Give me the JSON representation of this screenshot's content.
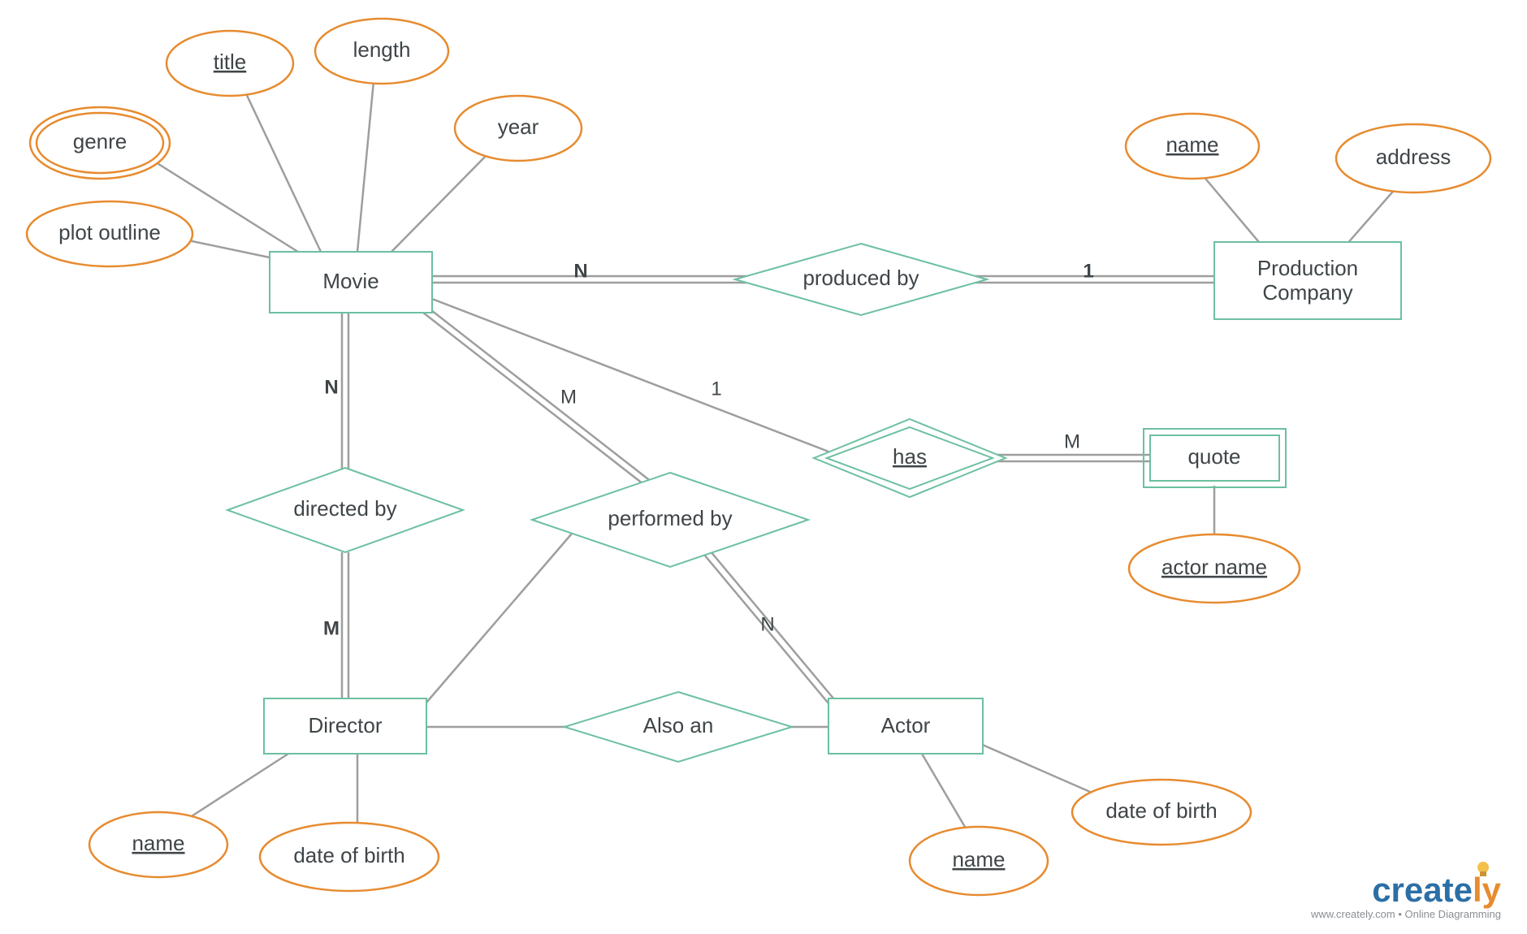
{
  "entities": {
    "movie": "Movie",
    "production_company_l1": "Production",
    "production_company_l2": "Company",
    "director": "Director",
    "actor": "Actor",
    "quote": "quote"
  },
  "relationships": {
    "produced_by": "produced by",
    "directed_by": "directed by",
    "performed_by": "performed by",
    "has": "has",
    "also_an": "Also an"
  },
  "attributes": {
    "movie": {
      "genre": "genre",
      "title": "title",
      "length": "length",
      "year": "year",
      "plot_outline": "plot outline"
    },
    "production_company": {
      "name": "name",
      "address": "address"
    },
    "director": {
      "name": "name",
      "dob": "date of birth"
    },
    "actor": {
      "name": "name",
      "dob": "date of birth"
    },
    "quote": {
      "actor_name": "actor name"
    }
  },
  "cardinalities": {
    "movie_produced": "N",
    "company_produced": "1",
    "movie_directed": "N",
    "director_directed": "M",
    "movie_performed": "M",
    "actor_performed": "N",
    "movie_has": "1",
    "quote_has": "M"
  },
  "footer": {
    "brand_part1": "create",
    "brand_part2": "ly",
    "sub": "www.creately.com • Online Diagramming"
  }
}
